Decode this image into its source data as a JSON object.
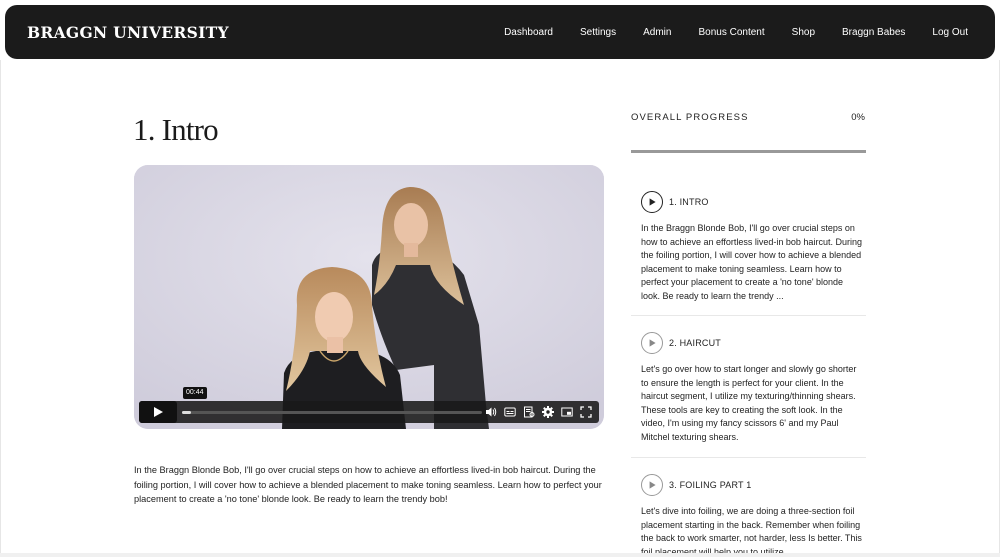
{
  "nav": {
    "brand": "BRAGGN UNIVERSITY",
    "links": [
      "Dashboard",
      "Settings",
      "Admin",
      "Bonus Content",
      "Shop",
      "Braggn Babes",
      "Log Out"
    ]
  },
  "page": {
    "title": "1. Intro",
    "description": "In the Braggn Blonde Bob, I'll go over crucial steps on how to achieve an effortless lived-in bob haircut. During the foiling portion, I will cover how to achieve a blended placement to make toning seamless. Learn how to perfect your placement to create a 'no tone' blonde look. Be ready to learn the trendy bob!"
  },
  "video": {
    "time": "00:44",
    "progress": 0.03
  },
  "sidebar": {
    "progress_label": "OVERALL PROGRESS",
    "progress_value": "0%",
    "progress_fraction": 0.0,
    "lessons": [
      {
        "title": "1. INTRO",
        "description": "In the Braggn Blonde Bob, I'll go over crucial steps on how to achieve an effortless lived-in bob haircut. During the foiling portion, I will cover how to achieve a blended placement to make toning seamless. Learn how to perfect your placement to create a 'no tone' blonde look. Be ready to learn the trendy ..."
      },
      {
        "title": "2. HAIRCUT",
        "description": "Let's go over how to start longer and slowly go shorter to ensure the length is perfect for your client. In the haircut segment, I utilize my texturing/thinning shears. These tools are key to creating the soft look. In the video, I'm using my fancy scissors 6' and my Paul Mitchel texturing shears."
      },
      {
        "title": "3. FOILING PART 1",
        "description": "Let's dive into foiling, we are doing a three-section foil placement starting in the back. Remember when foiling the back to work smarter, not harder, less Is better. This foil placement will help you to utilize"
      }
    ]
  },
  "colors": {
    "navbar_bg": "#1b1b1b",
    "video_bg": "#dcdae6"
  }
}
